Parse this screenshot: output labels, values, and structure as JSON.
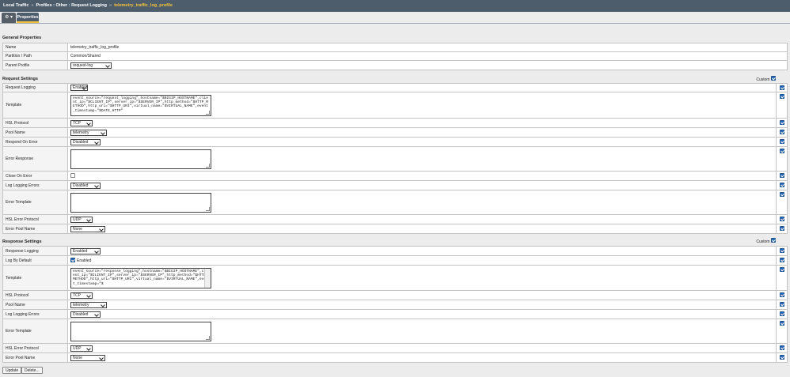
{
  "breadcrumb": {
    "items": [
      "Local Traffic",
      "Profiles : Other : Request Logging"
    ],
    "current": "telemetry_traffic_log_profile"
  },
  "tabs": {
    "gear": "⚙ ▾",
    "properties": "Properties"
  },
  "general": {
    "title": "General Properties",
    "name_label": "Name",
    "name_value": "telemetry_traffic_log_profile",
    "partition_label": "Partition / Path",
    "partition_value": "Common/Shared",
    "parent_label": "Parent Profile",
    "parent_value": "request-log"
  },
  "request": {
    "title": "Request Settings",
    "custom_label": "Custom",
    "logging_label": "Request Logging",
    "logging_value": "Enabled",
    "template_label": "Template",
    "template_value": "event_source=\"request_logging\",hostname=\"$BIGIP_HOSTNAME\",client_ip=\"$CLIENT_IP\",server_ip=\"$SERVER_IP\",http_method=\"$HTTP_METHOD\",http_uri=\"$HTTP_URI\",virtual_name=\"$VIRTUAL_NAME\",event_timestamp=\"$DATE_HTTP\"",
    "hsl_label": "HSL Protocol",
    "hsl_value": "TCP",
    "pool_label": "Pool Name",
    "pool_value": "telemetry",
    "respond_label": "Respond On Error",
    "respond_value": "Disabled",
    "error_response_label": "Error Response",
    "close_label": "Close On Error",
    "log_errors_label": "Log Logging Errors",
    "log_errors_value": "Disabled",
    "error_template_label": "Error Template",
    "hsl_error_label": "HSL Error Protocol",
    "hsl_error_value": "UDP",
    "error_pool_label": "Error Pool Name",
    "error_pool_value": "None"
  },
  "response": {
    "title": "Response Settings",
    "custom_label": "Custom",
    "logging_label": "Response Logging",
    "logging_value": "Enabled",
    "default_label": "Log By Default",
    "default_value": "Enabled",
    "template_label": "Template",
    "template_value": "event_source=\"response_logging\",hostname=\"$BIGIP_HOSTNAME\",client_ip=\"$CLIENT_IP\",server_ip=\"$SERVER_IP\",http_method=\"$HTTP_METHOD\",http_uri=\"$HTTP_URI\",virtual_name=\"$VIRTUAL_NAME\",event_timestamp=\"$",
    "hsl_label": "HSL Protocol",
    "hsl_value": "TCP",
    "pool_label": "Pool Name",
    "pool_value": "telemetry",
    "log_errors_label": "Log Logging Errors",
    "log_errors_value": "Disabled",
    "error_template_label": "Error Template",
    "hsl_error_label": "HSL Error Protocol",
    "hsl_error_value": "UDP",
    "error_pool_label": "Error Pool Name",
    "error_pool_value": "None"
  },
  "buttons": {
    "update": "Update",
    "delete": "Delete..."
  },
  "colors": {
    "header_bg": "#4e5d6c",
    "accent": "#f5c33b",
    "checkbox": "#2a6bb8"
  }
}
